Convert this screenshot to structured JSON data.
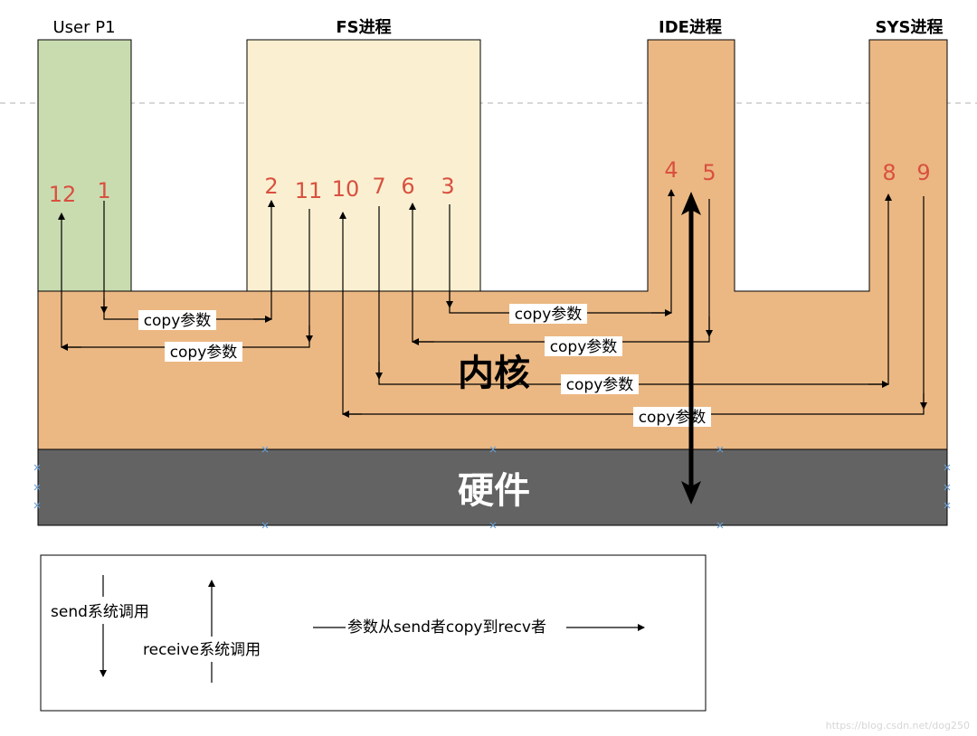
{
  "processes": {
    "user": "User P1",
    "fs": "FS进程",
    "ide": "IDE进程",
    "sys": "SYS进程"
  },
  "kernel_label": "内核",
  "hardware_label": "硬件",
  "steps": {
    "s1": "1",
    "s2": "2",
    "s3": "3",
    "s4": "4",
    "s5": "5",
    "s6": "6",
    "s7": "7",
    "s8": "8",
    "s9": "9",
    "s10": "10",
    "s11": "11",
    "s12": "12"
  },
  "copy_label": "copy参数",
  "legend": {
    "send": "send系统调用",
    "receive": "receive系统调用",
    "copy": "参数从send者copy到recv者"
  },
  "watermark": "https://blog.csdn.net/dog250",
  "colors": {
    "user_fill": "#c9dcb0",
    "fs_fill": "#faf0d1",
    "kernel_fill": "#ebb883",
    "hardware_fill": "#636363",
    "step_number": "#d9503f",
    "dashed_line": "#b0b0b0",
    "handle_marker": "#6a9fd4"
  }
}
